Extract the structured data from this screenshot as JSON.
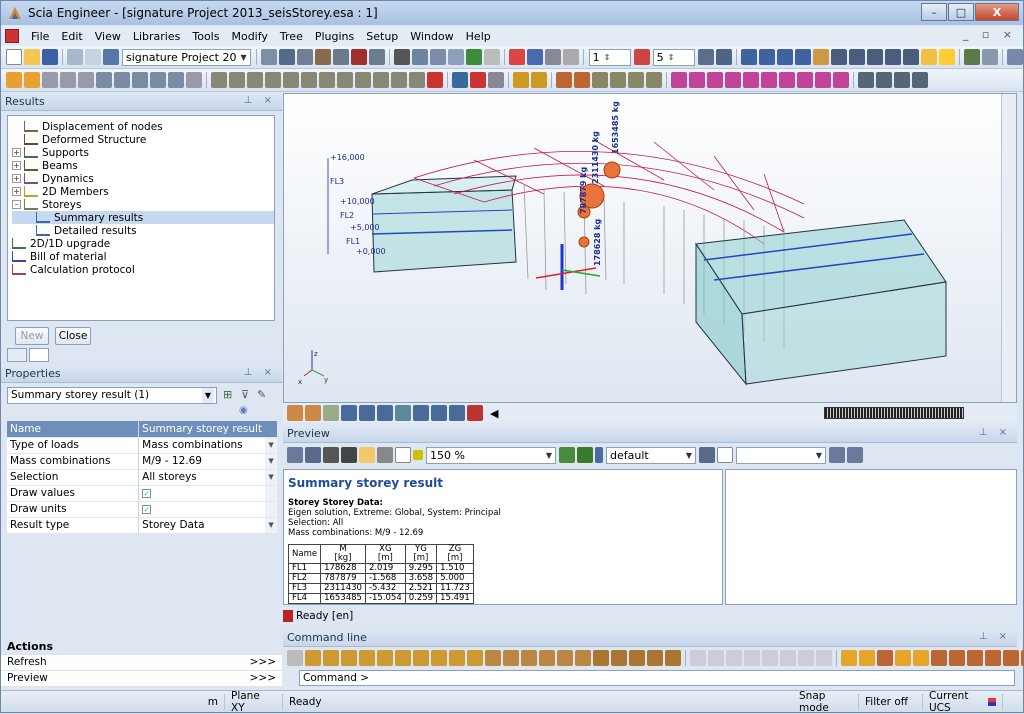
{
  "window": {
    "title": "Scia Engineer - [signature Project 2013_seisStorey.esa : 1]",
    "controls": [
      "–",
      "□",
      "X"
    ]
  },
  "menu": [
    "File",
    "Edit",
    "View",
    "Libraries",
    "Tools",
    "Modify",
    "Tree",
    "Plugins",
    "Setup",
    "Window",
    "Help"
  ],
  "toolbar": {
    "project_combo": "signature Project 20",
    "spin1": "1",
    "spin2": "5"
  },
  "results_panel": {
    "title": "Results",
    "tree": [
      {
        "label": "Displacement of nodes",
        "indent": 1,
        "exp": ""
      },
      {
        "label": "Deformed Structure",
        "indent": 1,
        "exp": ""
      },
      {
        "label": "Supports",
        "indent": 0,
        "exp": "+"
      },
      {
        "label": "Beams",
        "indent": 0,
        "exp": "+"
      },
      {
        "label": "Dynamics",
        "indent": 0,
        "exp": "+"
      },
      {
        "label": "2D Members",
        "indent": 0,
        "exp": "+"
      },
      {
        "label": "Storeys",
        "indent": 0,
        "exp": "–"
      },
      {
        "label": "Summary results",
        "indent": 2,
        "exp": "",
        "selected": true
      },
      {
        "label": "Detailed results",
        "indent": 2,
        "exp": ""
      },
      {
        "label": "2D/1D upgrade",
        "indent": 0,
        "exp": ""
      },
      {
        "label": "Bill of material",
        "indent": 0,
        "exp": ""
      },
      {
        "label": "Calculation protocol",
        "indent": 0,
        "exp": ""
      }
    ],
    "new_label": "New",
    "close_label": "Close"
  },
  "properties_panel": {
    "title": "Properties",
    "combo": "Summary storey result (1)",
    "rows": [
      {
        "name": "Name",
        "value": "Summary storey result",
        "dd": false,
        "head": true
      },
      {
        "name": "Type of loads",
        "value": "Mass combinations",
        "dd": true
      },
      {
        "name": "Mass combinations",
        "value": "M/9 - 12.69",
        "dd": true
      },
      {
        "name": "Selection",
        "value": "All storeys",
        "dd": true
      },
      {
        "name": "Draw values",
        "value": "✓",
        "dd": false,
        "check": true
      },
      {
        "name": "Draw units",
        "value": "✓",
        "dd": false,
        "check": true
      },
      {
        "name": "Result type",
        "value": "Storey Data",
        "dd": true
      }
    ]
  },
  "actions_panel": {
    "title": "Actions",
    "items": [
      {
        "label": "Refresh",
        "more": ">>>"
      },
      {
        "label": "Preview",
        "more": ">>>"
      }
    ]
  },
  "viewport": {
    "levels": [
      "+16,000",
      "+10,000",
      "+5,000",
      "+0,000"
    ],
    "floors": [
      "FL3",
      "FL2",
      "FL1"
    ],
    "masses": [
      "1653485 kg",
      "2311430 kg",
      "787879 kg",
      "178628 kg"
    ],
    "axis_z": "z",
    "axis_x": "x",
    "axis_y": "y"
  },
  "preview_panel": {
    "title": "Preview",
    "zoom": "150 %",
    "style_combo": "default",
    "doc_title": "Summary storey result",
    "doc_lines": [
      "Storey Storey Data:",
      "Eigen solution, Extreme: Global, System: Principal",
      "Selection: All",
      "Mass combinations: M/9 - 12.69"
    ],
    "table": {
      "headers": [
        [
          "Name",
          ""
        ],
        [
          "M",
          "[kg]"
        ],
        [
          "XG",
          "[m]"
        ],
        [
          "YG",
          "[m]"
        ],
        [
          "ZG",
          "[m]"
        ]
      ],
      "rows": [
        [
          "FL1",
          "178628",
          "2.019",
          "9.295",
          "1.510"
        ],
        [
          "FL2",
          "787879",
          "-1.568",
          "3.658",
          "5.000"
        ],
        [
          "FL3",
          "2311430",
          "-5.432",
          "2.521",
          "11.723"
        ],
        [
          "FL4",
          "1653485",
          "-15.054",
          "0.259",
          "15.491"
        ]
      ]
    },
    "ready": "Ready [en]"
  },
  "command_panel": {
    "title": "Command line",
    "prompt": "Command >"
  },
  "statusbar": {
    "units": "m",
    "plane": "Plane XY",
    "state": "Ready",
    "snap": "Snap mode",
    "filter": "Filter off",
    "ucs": "Current UCS"
  }
}
